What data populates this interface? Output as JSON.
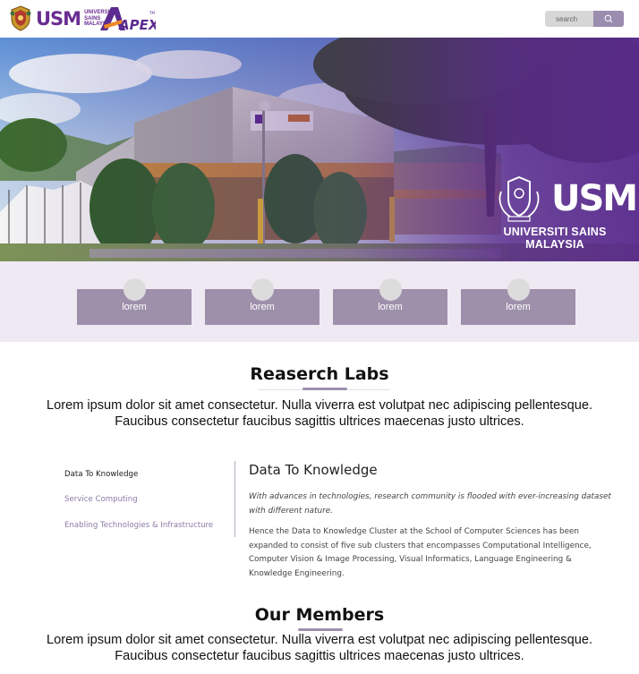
{
  "header": {
    "usm_mark": "USM",
    "usm_words": [
      "UNIVERSITI",
      "SAINS",
      "MALAYSIA"
    ],
    "apex_mark": "APEX",
    "apex_tm": "TM",
    "search": {
      "placeholder": "search"
    }
  },
  "hero": {
    "usm_mark": "USM",
    "university_name": "UNIVERSITI SAINS MALAYSIA",
    "overlay_color": "#5a2a8c"
  },
  "quick_links": [
    "lorem",
    "lorem",
    "lorem",
    "lorem"
  ],
  "research_labs": {
    "title": "Reaserch Labs",
    "intro": "Lorem ipsum dolor sit amet consectetur. Nulla viverra est volutpat nec adipiscing pellentesque. Faucibus consectetur faucibus sagittis ultrices maecenas justo ultrices.",
    "tabs": [
      {
        "label": "Data To Knowledge",
        "active": true
      },
      {
        "label": "Service Computing",
        "active": false
      },
      {
        "label": "Enabling Technologies & Infrastructure",
        "active": false
      }
    ],
    "detail": {
      "heading": "Data To Knowledge",
      "italic": "With advances in technologies, research community is flooded with ever-increasing dataset with different nature.",
      "body": "Hence the Data to Knowledge Cluster at the School of Computer Sciences has been expanded to consist of five sub clusters that encompasses Computational Intelligence, Computer Vision & Image Processing, Visual Informatics, Language Engineering & Knowledge Engineering."
    }
  },
  "members": {
    "title": "Our Members",
    "intro": "Lorem ipsum dolor sit amet consectetur. Nulla viverra est volutpat nec adipiscing pellentesque. Faucibus consectetur faucibus sagittis ultrices maecenas justo ultrices."
  },
  "colors": {
    "brand_purple": "#6a2c91",
    "card_mauve": "#9e90ab",
    "band_lavender": "#efe9f3",
    "nav_inactive": "#8a7ba6"
  }
}
